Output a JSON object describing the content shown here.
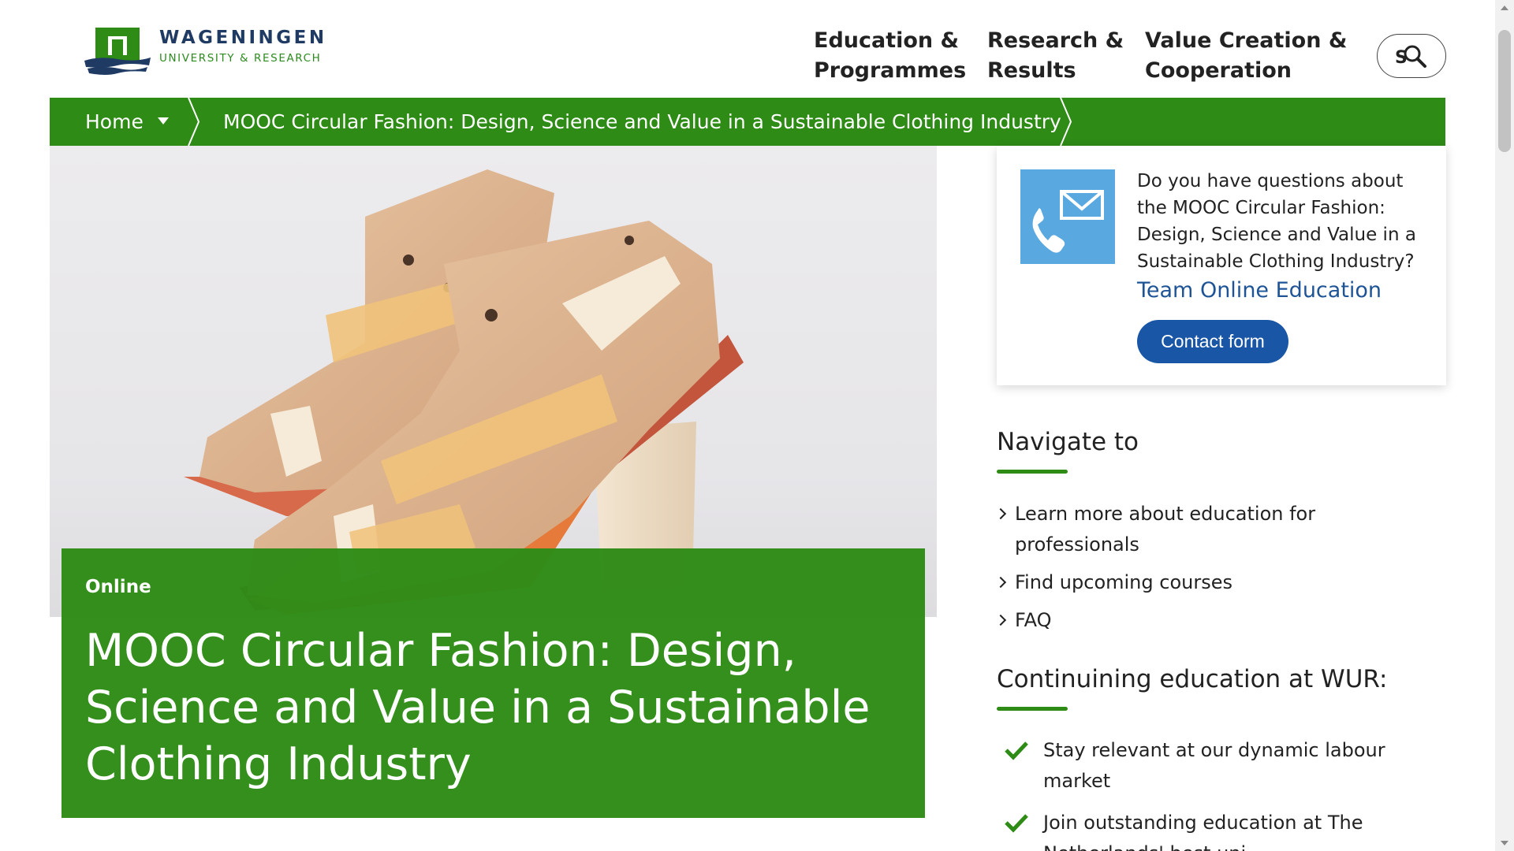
{
  "logo": {
    "wordmark": "WAGENINGEN",
    "subtitle": "UNIVERSITY & RESEARCH"
  },
  "nav": {
    "items": [
      {
        "line1": "Education &",
        "line2": "Programmes"
      },
      {
        "line1": "Research &",
        "line2": "Results"
      },
      {
        "line1": "Value Creation &",
        "line2": "Cooperation"
      }
    ],
    "search_icon": "search-icon"
  },
  "breadcrumb": {
    "home": "Home",
    "current": "MOOC Circular Fashion: Design, Science and Value in a Sustainable Clothing Industry"
  },
  "hero": {
    "image": "wooden-shoe-lasts-photo",
    "tag": "Online",
    "title": "MOOC Circular Fashion: Design, Science and Value in a Sustainable Clothing Industry"
  },
  "contact": {
    "icon": "phone-mail-icon",
    "question": "Do you have questions about the MOOC Circular Fashion: Design, Science and Value in a Sustainable Clothing Industry?",
    "team": "Team Online Education",
    "button": "Contact form"
  },
  "navigate": {
    "heading": "Navigate to",
    "items": [
      "Learn more about education for professionals",
      "Find upcoming courses",
      "FAQ"
    ]
  },
  "continuing": {
    "heading": "Continuining education at WUR:",
    "items": [
      "Stay relevant at our dynamic labour market",
      "Join outstanding education at The Netherlands' best uni"
    ]
  },
  "colors": {
    "brand_green": "#2e8b16",
    "brand_navy": "#1f3a63",
    "link_blue": "#1e5496",
    "button_blue": "#1a56a6",
    "contact_icon_bg": "#5aa8e0"
  }
}
